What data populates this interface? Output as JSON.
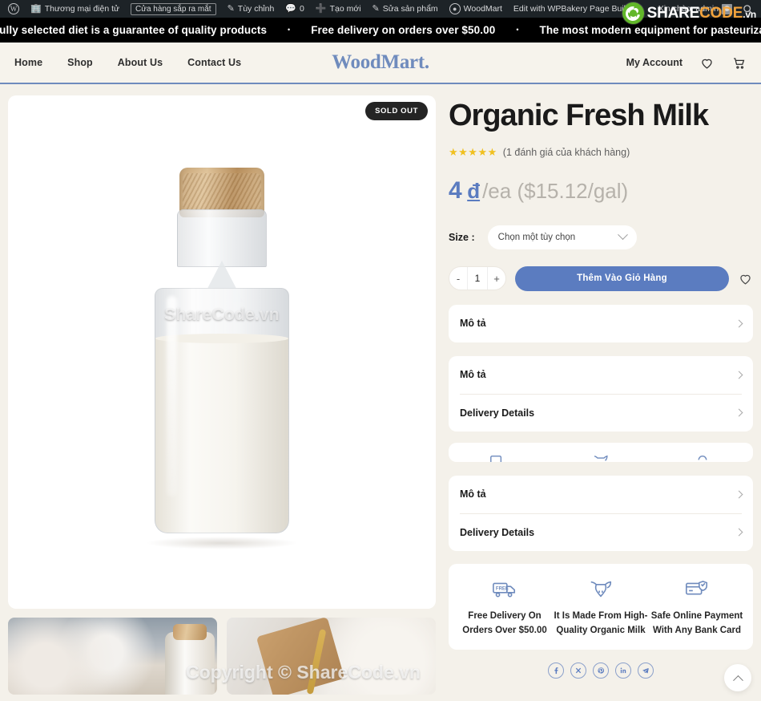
{
  "adminbar": {
    "items": [
      {
        "icon": "wordpress-icon",
        "label": ""
      },
      {
        "icon": "store-icon",
        "label": "Thương mại điện tử"
      },
      {
        "icon": "",
        "label": "Cửa hàng sắp ra mắt",
        "boxed": true
      },
      {
        "icon": "pencil-icon",
        "label": "Tùy chỉnh"
      },
      {
        "icon": "comment-icon",
        "label": "0"
      },
      {
        "icon": "plus-icon",
        "label": "Tạo mới"
      },
      {
        "icon": "edit-icon",
        "label": "Sửa sản phẩm"
      },
      {
        "icon": "woodmart-icon",
        "label": "WoodMart"
      },
      {
        "icon": "",
        "label": "Edit with WPBakery Page Builder"
      }
    ],
    "greeting": "Xin chào, admin",
    "search_icon": "search-icon",
    "avatar": "user-avatar"
  },
  "sharecode_logo": {
    "share": "SHARE",
    "code": "CODE",
    "vn": ".vn",
    "mark_color": "#62b72a",
    "code_color": "#f2a33c"
  },
  "marquee": {
    "items": [
      "arefully selected diet is a guarantee of quality products",
      "Free delivery on orders over $50.00",
      "The most modern equipment for pasteurization of milk"
    ],
    "separator": "•"
  },
  "header": {
    "nav": [
      {
        "label": "Home"
      },
      {
        "label": "Shop"
      },
      {
        "label": "About Us"
      },
      {
        "label": "Contact Us"
      }
    ],
    "logo": "WoodMart.",
    "account_label": "My Account",
    "wishlist_icon": "heart-icon",
    "cart_icon": "cart-icon",
    "accent_color": "#6f8bbd"
  },
  "gallery": {
    "badge": "SOLD OUT",
    "watermark_main": "ShareCode.vn",
    "watermark_bottom": "Copyright © ShareCode.vn",
    "thumbs": [
      {
        "alt": "milk-bottles-cookies-thumbnail"
      },
      {
        "alt": "granola-jar-thumbnail"
      }
    ]
  },
  "product": {
    "title": "Organic Fresh Milk",
    "stars": "★★★★★",
    "rating_text": "(1 đánh giá của khách hàng)",
    "price_amount": "4",
    "price_currency": "đ",
    "price_suffix": "/ea ($15.12/gal)",
    "price_color": "#5b7cc0",
    "size_label": "Size :",
    "size_selected": "Chọn một tùy chọn",
    "qty_minus": "-",
    "qty_value": "1",
    "qty_plus": "+",
    "add_to_cart": "Thêm Vào Giỏ Hàng",
    "wishlist_icon": "heart-icon"
  },
  "accordions": [
    {
      "rows": [
        {
          "label": "Mô tả",
          "icon": "chevron-right-icon"
        }
      ]
    },
    {
      "rows": [
        {
          "label": "Mô tả",
          "icon": "chevron-right-icon"
        },
        {
          "label": "Delivery Details",
          "icon": "chevron-right-icon"
        }
      ]
    },
    {
      "rows": [
        {
          "label": "Mô tả",
          "icon": "chevron-right-icon"
        },
        {
          "label": "Delivery Details",
          "icon": "chevron-right-icon"
        }
      ]
    }
  ],
  "benefits": [
    {
      "icon": "delivery-truck-icon",
      "text": "Free Delivery On Orders Over $50.00"
    },
    {
      "icon": "cow-head-icon",
      "text": "It Is Made From High-Quality Organic Milk"
    },
    {
      "icon": "secure-card-icon",
      "text": "Safe Online Payment With Any Bank Card"
    }
  ],
  "social": [
    {
      "icon": "facebook-icon",
      "label": "f"
    },
    {
      "icon": "x-twitter-icon",
      "label": "✕"
    },
    {
      "icon": "pinterest-icon",
      "label": "ⓟ"
    },
    {
      "icon": "linkedin-icon",
      "label": "in"
    },
    {
      "icon": "telegram-icon",
      "label": "➤"
    }
  ],
  "scroll_top_icon": "chevron-up-icon"
}
